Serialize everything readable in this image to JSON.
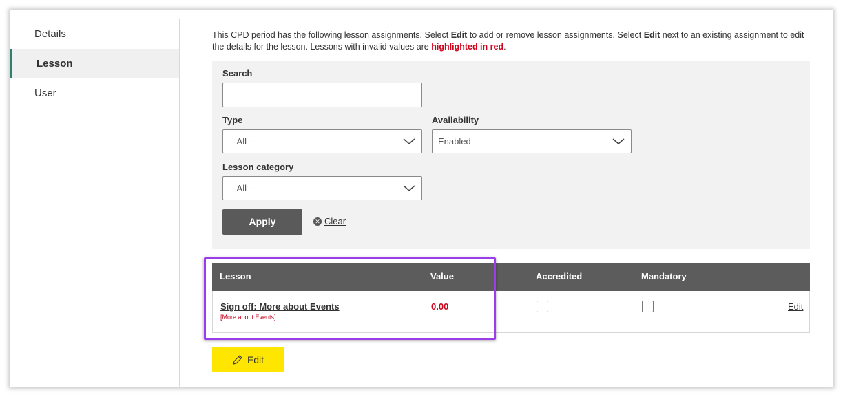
{
  "sidebar": {
    "items": [
      {
        "label": "Details"
      },
      {
        "label": "Lesson"
      },
      {
        "label": "User"
      }
    ]
  },
  "intro": {
    "part1": "This CPD period has the following lesson assignments. Select ",
    "bold1": "Edit",
    "part2": " to add or remove lesson assignments. Select ",
    "bold2": "Edit",
    "part3": " next to an existing assignment to edit the details for the lesson. Lessons with invalid values are ",
    "red": "highlighted in red",
    "part4": "."
  },
  "filters": {
    "search_label": "Search",
    "search_value": "",
    "type_label": "Type",
    "type_value": "-- All --",
    "availability_label": "Availability",
    "availability_value": "Enabled",
    "category_label": "Lesson category",
    "category_value": "-- All --",
    "apply_label": "Apply",
    "clear_label": "Clear"
  },
  "table": {
    "headers": {
      "lesson": "Lesson",
      "value": "Value",
      "accredited": "Accredited",
      "mandatory": "Mandatory"
    },
    "rows": [
      {
        "lesson": "Sign off: More about Events",
        "lesson_sub": "[More about Events]",
        "value": "0.00",
        "accredited": false,
        "mandatory": false,
        "edit": "Edit"
      }
    ]
  },
  "edit_button": {
    "label": "Edit"
  },
  "colors": {
    "accent_yellow": "#ffe600",
    "invalid_red": "#d0021b",
    "highlight_purple": "#9b3de8",
    "header_gray": "#5c5c5c"
  }
}
